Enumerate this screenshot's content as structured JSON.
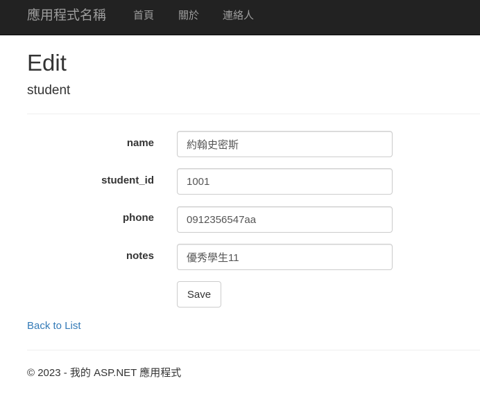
{
  "navbar": {
    "brand": "應用程式名稱",
    "links": [
      "首頁",
      "關於",
      "連絡人"
    ]
  },
  "page": {
    "title": "Edit",
    "subtitle": "student"
  },
  "form": {
    "fields": [
      {
        "label": "name",
        "value": "約翰史密斯"
      },
      {
        "label": "student_id",
        "value": "1001"
      },
      {
        "label": "phone",
        "value": "0912356547aa"
      },
      {
        "label": "notes",
        "value": "優秀學生11"
      }
    ],
    "save_label": "Save"
  },
  "back_link": "Back to List",
  "footer": "© 2023 - 我的 ASP.NET 應用程式",
  "colors": {
    "navbar_bg": "#222222",
    "nav_text": "#9d9d9d",
    "link": "#337ab7"
  }
}
